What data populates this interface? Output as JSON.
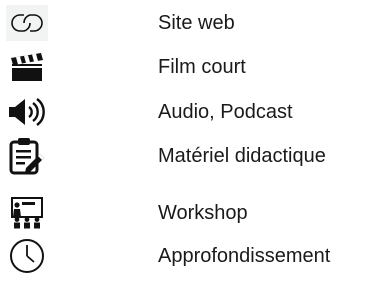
{
  "legend": {
    "items": [
      {
        "icon": "link-icon",
        "label": "Site web"
      },
      {
        "icon": "clapperboard-icon",
        "label": "Film court"
      },
      {
        "icon": "speaker-icon",
        "label": "Audio, Podcast"
      },
      {
        "icon": "clipboard-pencil-icon",
        "label": "Matériel didactique"
      },
      {
        "icon": "presentation-icon",
        "label": "Workshop"
      },
      {
        "icon": "clock-icon",
        "label": "Approfondissement"
      }
    ]
  },
  "colors": {
    "icon": "#111111",
    "link_icon_bg": "#f2f3f3",
    "text": "#1a1a1a"
  }
}
